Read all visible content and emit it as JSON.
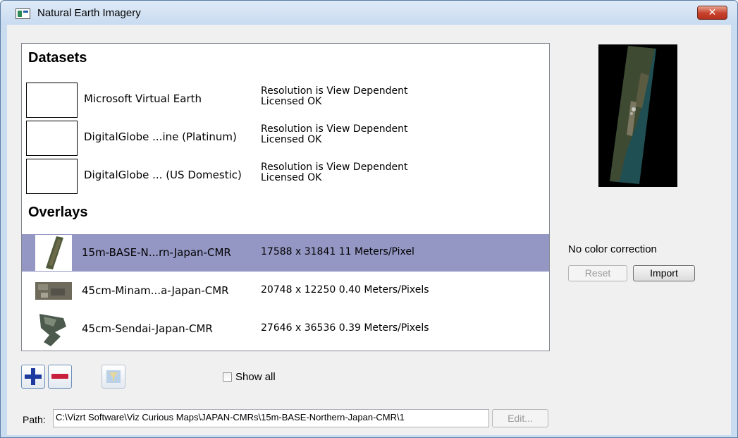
{
  "window": {
    "title": "Natural Earth Imagery",
    "close_label": "✕"
  },
  "datasets": {
    "heading": "Datasets",
    "items": [
      {
        "name": "Microsoft Virtual Earth",
        "resolution": "Resolution is View Dependent",
        "license": "Licensed OK"
      },
      {
        "name": "DigitalGlobe ...ine (Platinum)",
        "resolution": "Resolution is View Dependent",
        "license": "Licensed OK"
      },
      {
        "name": "DigitalGlobe ... (US Domestic)",
        "resolution": "Resolution is View Dependent",
        "license": "Licensed OK"
      }
    ]
  },
  "overlays": {
    "heading": "Overlays",
    "items": [
      {
        "name": "15m-BASE-N...rn-Japan-CMR",
        "info": "17588 x 31841 11 Meters/Pixel",
        "selected": true
      },
      {
        "name": "45cm-Minam...a-Japan-CMR",
        "info": "20748 x 12250  0.40 Meters/Pixels",
        "selected": false
      },
      {
        "name": "45cm-Sendai-Japan-CMR",
        "info": "27646 x 36536  0.39 Meters/Pixels",
        "selected": false
      }
    ]
  },
  "color_correction": {
    "label": "No color correction",
    "reset_label": "Reset",
    "import_label": "Import"
  },
  "toolbar": {
    "show_all_label": "Show all",
    "show_all_checked": false
  },
  "path": {
    "label": "Path:",
    "value": "C:\\Vizrt Software\\Viz Curious Maps\\JAPAN-CMRs\\15m-BASE-Northern-Japan-CMR\\1",
    "edit_label": "Edit..."
  },
  "colors": {
    "selection": "#9496c3",
    "window_frame": "#c9dcf0",
    "close_button": "#c6402a"
  }
}
